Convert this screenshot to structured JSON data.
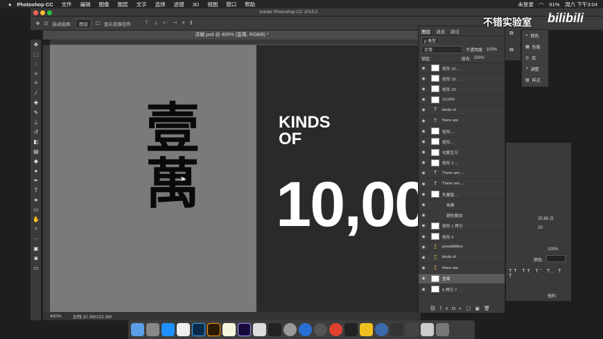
{
  "menubar": {
    "app": "Photoshop CC",
    "items": [
      "文件",
      "编辑",
      "图像",
      "图层",
      "文字",
      "选择",
      "滤镜",
      "3D",
      "视图",
      "窗口",
      "帮助"
    ],
    "status": {
      "user": "未登录",
      "battery": "91%",
      "clock": "周六 下午3:04"
    }
  },
  "window": {
    "title": "Adobe Photoshop CC 2015.5"
  },
  "options": {
    "auto_select": "自动选择:",
    "target": "图层",
    "show_transform": "显示变换控件"
  },
  "document": {
    "tab": "讲解.psd @ 400% (壹萬, RGB/8) *",
    "zoom": "400%",
    "doc_size": "文档:10.3M/131.8M"
  },
  "artwork": {
    "char1": "壹",
    "char2": "萬",
    "kinds": "KINDS\nOF",
    "number": "10,00"
  },
  "layers_panel": {
    "tabs": [
      "图层",
      "通道",
      "路径"
    ],
    "kind": "ρ 类型",
    "blend": "正常",
    "opacity_label": "不透明度:",
    "opacity": "100%",
    "lock_label": "锁定:",
    "fill_label": "填充:",
    "fill": "100%",
    "layers": [
      {
        "icon": "shape",
        "name": "矩形 10 ..."
      },
      {
        "icon": "shape",
        "name": "矩形 10 ..."
      },
      {
        "icon": "shape",
        "name": "矩形 10"
      },
      {
        "icon": "shape",
        "name": "10,000"
      },
      {
        "icon": "text",
        "name": "kinds of"
      },
      {
        "icon": "text",
        "name": "there are"
      },
      {
        "icon": "shape",
        "name": "矩形..."
      },
      {
        "icon": "shape",
        "name": "矩形..."
      },
      {
        "icon": "shape",
        "name": "化繁生万"
      },
      {
        "icon": "shape",
        "name": "矩形 1 ..."
      },
      {
        "icon": "text",
        "name": "There are ..."
      },
      {
        "icon": "text",
        "name": "There are ..."
      },
      {
        "icon": "shape",
        "name": "矢量智..."
      },
      {
        "icon": "none",
        "name": "效果"
      },
      {
        "icon": "none",
        "name": "颜色叠加"
      },
      {
        "icon": "shape",
        "name": "矩形 1 拷贝"
      },
      {
        "icon": "shape",
        "name": "矩形 9"
      },
      {
        "icon": "textwarn",
        "name": "possibilities"
      },
      {
        "icon": "textwarn",
        "name": "kinds of"
      },
      {
        "icon": "textwarn",
        "name": "there are"
      },
      {
        "icon": "shape",
        "name": "壹萬"
      },
      {
        "icon": "shape",
        "name": "0 拷贝 7"
      }
    ]
  },
  "popup": {
    "items": [
      "颜色",
      "色板",
      "库",
      "调整",
      "样式"
    ]
  },
  "char_panel": {
    "size": "25.88 点",
    "tracking": "20",
    "scale": "100%",
    "color_label": "颜色:",
    "aa": "锐利"
  },
  "watermark": "不错实验室",
  "logo": "bilibili",
  "colors": {
    "bg_dark": "#1e1e1e",
    "canvas_gray": "#7a7a7a",
    "panel": "#3b3b3b"
  }
}
